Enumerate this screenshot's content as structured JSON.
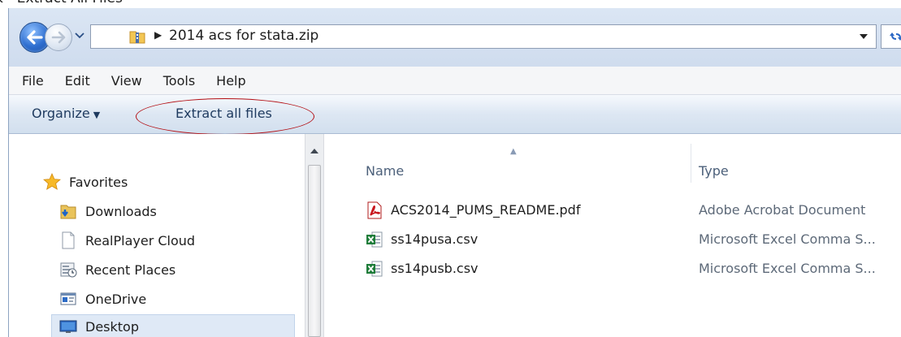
{
  "caption": "k - Extract All Files",
  "address": {
    "path": "2014 acs for stata.zip"
  },
  "menu": [
    "File",
    "Edit",
    "View",
    "Tools",
    "Help"
  ],
  "commands": {
    "organize": "Organize",
    "extract": "Extract all files"
  },
  "nav": [
    {
      "label": "Favorites",
      "icon": "star-icon"
    },
    {
      "label": "Downloads",
      "icon": "downloads-folder-icon"
    },
    {
      "label": "RealPlayer Cloud",
      "icon": "blank-page-icon"
    },
    {
      "label": "Recent Places",
      "icon": "recent-places-icon"
    },
    {
      "label": "OneDrive",
      "icon": "onedrive-icon"
    },
    {
      "label": "Desktop",
      "icon": "desktop-icon",
      "selected": true
    }
  ],
  "columns": {
    "name": "Name",
    "type": "Type"
  },
  "files": [
    {
      "name": "ACS2014_PUMS_README.pdf",
      "type": "Adobe Acrobat Document",
      "icon": "pdf-icon"
    },
    {
      "name": "ss14pusa.csv",
      "type": "Microsoft Excel Comma S...",
      "icon": "excel-csv-icon"
    },
    {
      "name": "ss14pusb.csv",
      "type": "Microsoft Excel Comma S...",
      "icon": "excel-csv-icon"
    }
  ],
  "colors": {
    "annotation_circle": "#b30d12",
    "accent": "#2f6fd0"
  }
}
